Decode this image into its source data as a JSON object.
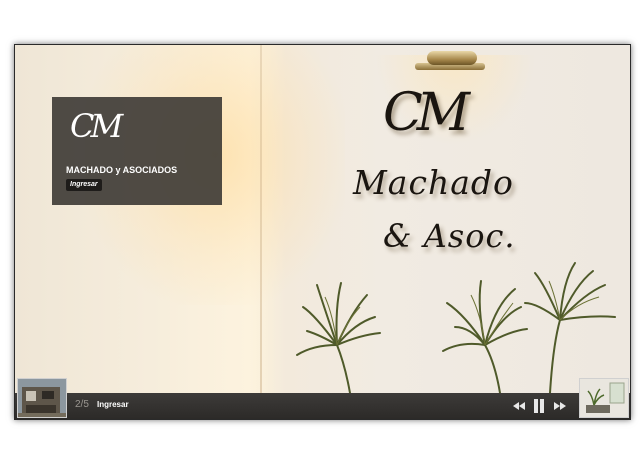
{
  "caption": {
    "logo_text": "CM",
    "title": "MACHADO y ASOCIADOS",
    "button_label": "Ingresar"
  },
  "sign": {
    "logo_text": "CM",
    "line1": "Machado",
    "line2": "& Asoc."
  },
  "controls": {
    "counter": "2/5",
    "link_label": "Ingresar",
    "prev_icon": "rewind-icon",
    "pause_icon": "pause-icon",
    "next_icon": "fast-forward-icon"
  },
  "colors": {
    "bar": "#2c2a28",
    "caption_bg": "#3c3834",
    "counter_text": "#9a9690"
  }
}
